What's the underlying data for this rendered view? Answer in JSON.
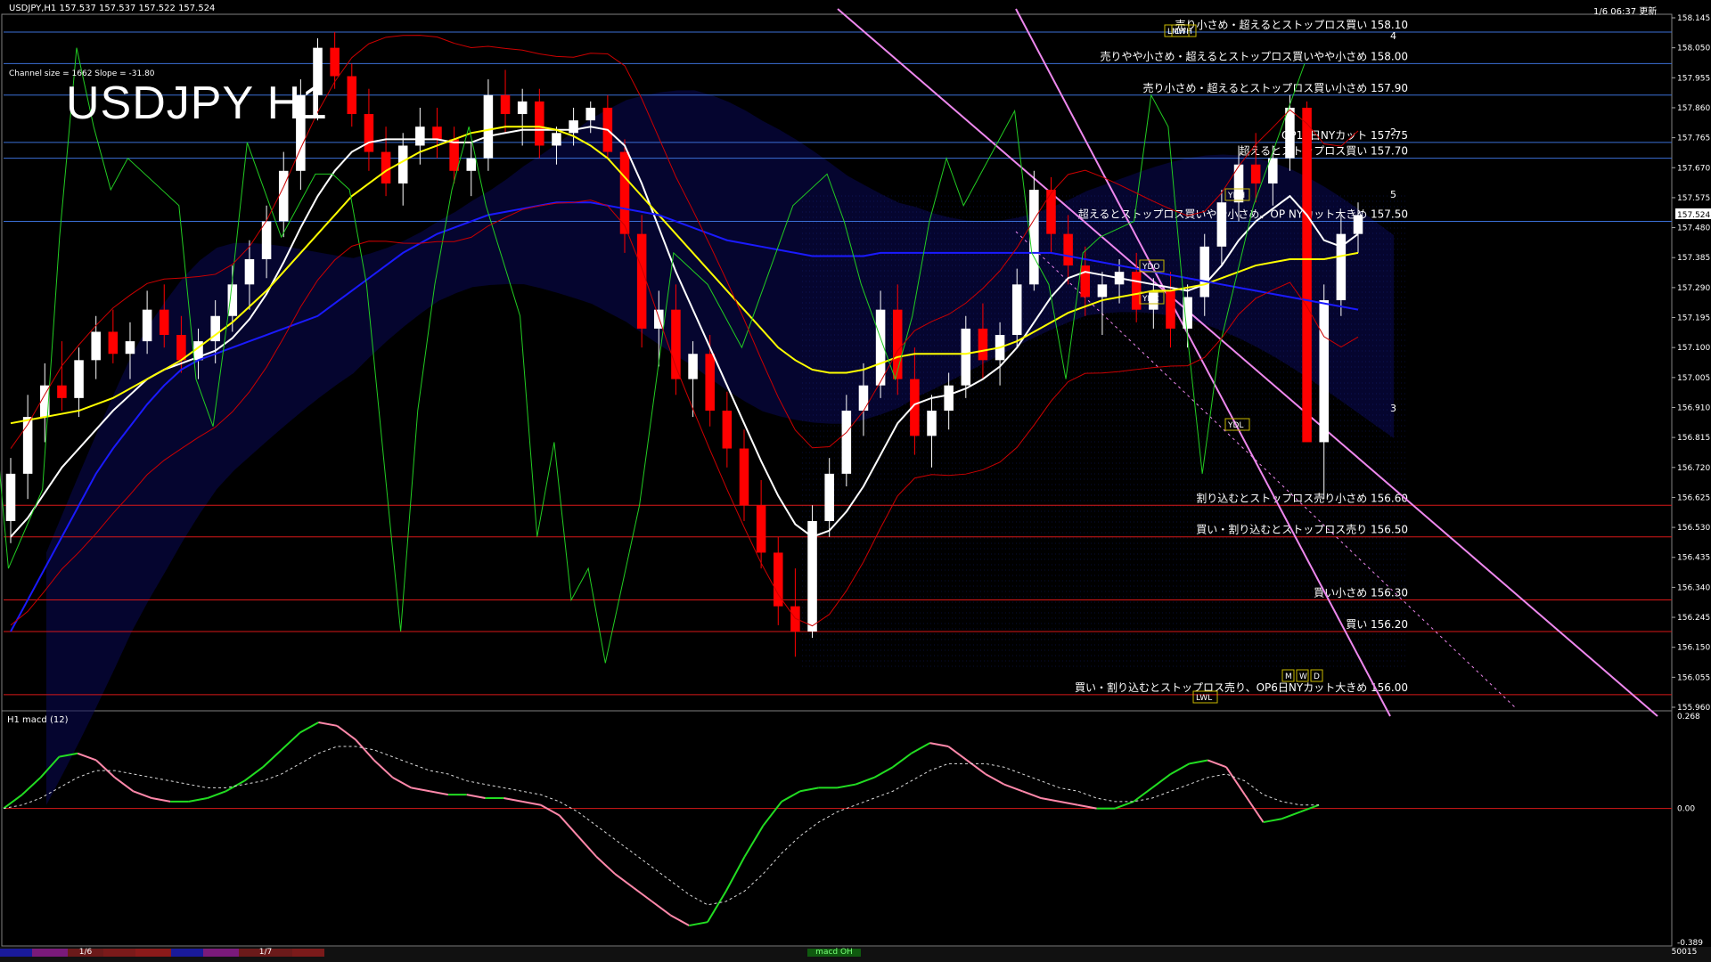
{
  "header": {
    "symbol_info": "USDJPY,H1  157.537 157.537 157.522 157.524",
    "title": "USDJPY H1",
    "channel_info": "Channel size = 1662 Slope = -31.80",
    "updated": "1/6 06:37 更新"
  },
  "colors": {
    "background": "#000000",
    "bull_candle": "#ffffff",
    "bear_candle": "#ff0000",
    "ma_white": "#ffffff",
    "ma_yellow": "#ffff00",
    "ma_blue": "#1a1aff",
    "chikou_green": "#22cc22",
    "bollinger_red": "#cc0000",
    "level_blue": "#3b6fd6",
    "level_red": "#d81818",
    "channel_pink": "#ee88ee",
    "macd_green": "#22dd22",
    "macd_pink": "#ff88aa"
  },
  "chart_data": [
    {
      "type": "line",
      "name": "price",
      "ylim": [
        155.96,
        158.145
      ],
      "y_ticks": [
        "158.145",
        "158.050",
        "157.955",
        "157.860",
        "157.765",
        "157.670",
        "157.575",
        "157.480",
        "157.385",
        "157.290",
        "157.195",
        "157.100",
        "157.005",
        "156.910",
        "156.815",
        "156.720",
        "156.625",
        "156.530",
        "156.435",
        "156.340",
        "156.245",
        "156.150",
        "156.055",
        "155.960"
      ],
      "current_price": "157.524",
      "candles_ohlc": [
        [
          156.55,
          156.75,
          156.48,
          156.7
        ],
        [
          156.7,
          156.95,
          156.62,
          156.88
        ],
        [
          156.88,
          157.05,
          156.8,
          156.98
        ],
        [
          156.98,
          157.12,
          156.9,
          156.94
        ],
        [
          156.94,
          157.1,
          156.88,
          157.06
        ],
        [
          157.06,
          157.2,
          157.0,
          157.15
        ],
        [
          157.15,
          157.22,
          157.05,
          157.08
        ],
        [
          157.08,
          157.18,
          157.0,
          157.12
        ],
        [
          157.12,
          157.28,
          157.08,
          157.22
        ],
        [
          157.22,
          157.3,
          157.1,
          157.14
        ],
        [
          157.14,
          157.2,
          157.02,
          157.06
        ],
        [
          157.06,
          157.16,
          157.0,
          157.12
        ],
        [
          157.12,
          157.25,
          157.05,
          157.2
        ],
        [
          157.2,
          157.36,
          157.15,
          157.3
        ],
        [
          157.3,
          157.44,
          157.22,
          157.38
        ],
        [
          157.38,
          157.55,
          157.32,
          157.5
        ],
        [
          157.5,
          157.72,
          157.45,
          157.66
        ],
        [
          157.66,
          157.95,
          157.6,
          157.9
        ],
        [
          157.9,
          158.08,
          157.82,
          158.05
        ],
        [
          158.05,
          158.1,
          157.92,
          157.96
        ],
        [
          157.96,
          158.0,
          157.8,
          157.84
        ],
        [
          157.84,
          157.92,
          157.66,
          157.72
        ],
        [
          157.72,
          157.8,
          157.58,
          157.62
        ],
        [
          157.62,
          157.78,
          157.55,
          157.74
        ],
        [
          157.74,
          157.86,
          157.68,
          157.8
        ],
        [
          157.8,
          157.86,
          157.7,
          157.76
        ],
        [
          157.76,
          157.8,
          157.62,
          157.66
        ],
        [
          157.66,
          157.75,
          157.58,
          157.7
        ],
        [
          157.7,
          157.95,
          157.66,
          157.9
        ],
        [
          157.9,
          157.98,
          157.78,
          157.84
        ],
        [
          157.84,
          157.92,
          157.74,
          157.88
        ],
        [
          157.88,
          157.92,
          157.7,
          157.74
        ],
        [
          157.74,
          157.8,
          157.68,
          157.78
        ],
        [
          157.78,
          157.86,
          157.74,
          157.82
        ],
        [
          157.82,
          157.88,
          157.78,
          157.86
        ],
        [
          157.86,
          157.9,
          157.7,
          157.72
        ],
        [
          157.72,
          157.76,
          157.4,
          157.46
        ],
        [
          157.46,
          157.52,
          157.1,
          157.16
        ],
        [
          157.16,
          157.28,
          157.04,
          157.22
        ],
        [
          157.22,
          157.3,
          156.95,
          157.0
        ],
        [
          157.0,
          157.12,
          156.88,
          157.08
        ],
        [
          157.08,
          157.14,
          156.85,
          156.9
        ],
        [
          156.9,
          156.96,
          156.72,
          156.78
        ],
        [
          156.78,
          156.84,
          156.55,
          156.6
        ],
        [
          156.6,
          156.68,
          156.4,
          156.45
        ],
        [
          156.45,
          156.5,
          156.22,
          156.28
        ],
        [
          156.28,
          156.4,
          156.12,
          156.2
        ],
        [
          156.2,
          156.6,
          156.18,
          156.55
        ],
        [
          156.55,
          156.75,
          156.5,
          156.7
        ],
        [
          156.7,
          156.95,
          156.66,
          156.9
        ],
        [
          156.9,
          157.05,
          156.82,
          156.98
        ],
        [
          156.98,
          157.28,
          156.94,
          157.22
        ],
        [
          157.22,
          157.3,
          156.95,
          157.0
        ],
        [
          157.0,
          157.1,
          156.76,
          156.82
        ],
        [
          156.82,
          156.95,
          156.72,
          156.9
        ],
        [
          156.9,
          157.02,
          156.84,
          156.98
        ],
        [
          156.98,
          157.2,
          156.94,
          157.16
        ],
        [
          157.16,
          157.24,
          157.0,
          157.06
        ],
        [
          157.06,
          157.18,
          156.98,
          157.14
        ],
        [
          157.14,
          157.35,
          157.1,
          157.3
        ],
        [
          157.3,
          157.66,
          157.28,
          157.6
        ],
        [
          157.6,
          157.64,
          157.4,
          157.46
        ],
        [
          157.46,
          157.52,
          157.3,
          157.36
        ],
        [
          157.36,
          157.42,
          157.2,
          157.26
        ],
        [
          157.26,
          157.34,
          157.14,
          157.3
        ],
        [
          157.3,
          157.38,
          157.24,
          157.34
        ],
        [
          157.34,
          157.4,
          157.18,
          157.22
        ],
        [
          157.22,
          157.32,
          157.16,
          157.28
        ],
        [
          157.28,
          157.34,
          157.1,
          157.16
        ],
        [
          157.16,
          157.3,
          157.1,
          157.26
        ],
        [
          157.26,
          157.46,
          157.2,
          157.42
        ],
        [
          157.42,
          157.6,
          157.36,
          157.56
        ],
        [
          157.56,
          157.74,
          157.5,
          157.68
        ],
        [
          157.68,
          157.78,
          157.56,
          157.62
        ],
        [
          157.62,
          157.74,
          157.55,
          157.7
        ],
        [
          157.7,
          157.9,
          157.66,
          157.86
        ],
        [
          157.86,
          157.88,
          156.95,
          156.8
        ],
        [
          156.8,
          157.3,
          156.62,
          157.25
        ],
        [
          157.25,
          157.52,
          157.2,
          157.46
        ],
        [
          157.46,
          157.56,
          157.4,
          157.52
        ]
      ],
      "series": [
        {
          "name": "ma_white",
          "values": [
            156.5,
            156.56,
            156.64,
            156.72,
            156.78,
            156.84,
            156.9,
            156.95,
            157.0,
            157.03,
            157.05,
            157.07,
            157.09,
            157.13,
            157.19,
            157.27,
            157.37,
            157.48,
            157.58,
            157.66,
            157.72,
            157.75,
            157.76,
            157.76,
            157.76,
            157.76,
            157.75,
            157.75,
            157.77,
            157.78,
            157.79,
            157.79,
            157.79,
            157.79,
            157.8,
            157.79,
            157.74,
            157.62,
            157.48,
            157.34,
            157.22,
            157.1,
            156.98,
            156.86,
            156.74,
            156.63,
            156.54,
            156.5,
            156.52,
            156.58,
            156.66,
            156.76,
            156.86,
            156.92,
            156.94,
            156.95,
            156.97,
            157.0,
            157.04,
            157.1,
            157.18,
            157.26,
            157.32,
            157.34,
            157.33,
            157.32,
            157.31,
            157.3,
            157.29,
            157.28,
            157.3,
            157.36,
            157.44,
            157.5,
            157.54,
            157.58,
            157.52,
            157.44,
            157.42,
            157.46
          ]
        },
        {
          "name": "ma_yellow",
          "values": [
            156.86,
            156.87,
            156.88,
            156.89,
            156.9,
            156.92,
            156.94,
            156.97,
            157.0,
            157.03,
            157.06,
            157.1,
            157.14,
            157.18,
            157.23,
            157.28,
            157.34,
            157.4,
            157.46,
            157.52,
            157.58,
            157.62,
            157.66,
            157.69,
            157.72,
            157.74,
            157.76,
            157.78,
            157.79,
            157.8,
            157.8,
            157.8,
            157.79,
            157.77,
            157.74,
            157.7,
            157.64,
            157.58,
            157.52,
            157.46,
            157.4,
            157.34,
            157.28,
            157.22,
            157.16,
            157.1,
            157.06,
            157.03,
            157.02,
            157.02,
            157.03,
            157.05,
            157.07,
            157.08,
            157.08,
            157.08,
            157.08,
            157.09,
            157.1,
            157.12,
            157.15,
            157.18,
            157.21,
            157.23,
            157.25,
            157.26,
            157.27,
            157.28,
            157.28,
            157.29,
            157.3,
            157.32,
            157.34,
            157.36,
            157.37,
            157.38,
            157.38,
            157.38,
            157.39,
            157.4
          ]
        },
        {
          "name": "ma_blue",
          "values": [
            156.2,
            156.3,
            156.4,
            156.5,
            156.6,
            156.7,
            156.78,
            156.85,
            156.92,
            156.98,
            157.03,
            157.06,
            157.08,
            157.1,
            157.12,
            157.14,
            157.16,
            157.18,
            157.2,
            157.24,
            157.28,
            157.32,
            157.36,
            157.4,
            157.43,
            157.46,
            157.48,
            157.5,
            157.52,
            157.53,
            157.54,
            157.55,
            157.56,
            157.56,
            157.56,
            157.55,
            157.54,
            157.53,
            157.52,
            157.5,
            157.48,
            157.46,
            157.44,
            157.43,
            157.42,
            157.41,
            157.4,
            157.39,
            157.39,
            157.39,
            157.39,
            157.4,
            157.4,
            157.4,
            157.4,
            157.4,
            157.4,
            157.4,
            157.4,
            157.4,
            157.4,
            157.4,
            157.39,
            157.38,
            157.37,
            157.36,
            157.35,
            157.34,
            157.33,
            157.32,
            157.31,
            157.3,
            157.29,
            157.28,
            157.27,
            157.26,
            157.25,
            157.24,
            157.23,
            157.22
          ]
        },
        {
          "name": "chikou_green",
          "values": [
            157.55,
            157.6,
            157.0,
            156.4,
            156.65,
            157.45,
            158.05,
            157.8,
            157.6,
            157.7,
            157.6,
            157.55,
            157.0,
            156.85,
            157.25,
            157.75,
            157.45,
            157.55,
            157.65,
            157.65,
            157.6,
            157.3,
            156.2,
            156.9,
            157.3,
            157.6,
            157.8,
            157.55,
            157.2,
            156.5,
            156.8,
            156.3,
            156.4,
            156.1,
            156.6,
            157.0,
            157.4,
            157.35,
            157.3,
            157.2,
            157.1,
            157.4,
            157.55,
            157.6,
            157.65,
            157.5,
            157.3,
            157.0,
            157.2,
            157.5,
            157.7,
            157.55,
            157.65,
            157.85,
            157.4,
            157.3,
            157.0,
            157.4,
            157.45,
            157.5,
            157.9,
            157.8,
            157.2,
            156.7,
            157.1,
            157.55,
            157.7,
            157.85,
            158.0
          ]
        }
      ],
      "levels": [
        {
          "price": 158.1,
          "color": "blue",
          "label": "売り小さめ・超えるとストップロス買い 158.10"
        },
        {
          "price": 158.0,
          "color": "blue",
          "label": "売りやや小さめ・超えるとストップロス買いやや小さめ 158.00"
        },
        {
          "price": 157.9,
          "color": "blue",
          "label": "売り小さめ・超えるとストップロス買い小さめ 157.90"
        },
        {
          "price": 157.75,
          "color": "blue",
          "label": "OP10日NYカット 157.75"
        },
        {
          "price": 157.7,
          "color": "blue",
          "label": "超えるとストップロス買い 157.70"
        },
        {
          "price": 157.5,
          "color": "blue",
          "label": "超えるとストップロス買いやや小さめ、OP NYカット大きめ 157.50"
        },
        {
          "price": 156.6,
          "color": "red",
          "label": "割り込むとストップロス売り小さめ 156.60"
        },
        {
          "price": 156.5,
          "color": "red",
          "label": "買い・割り込むとストップロス売り 156.50"
        },
        {
          "price": 156.3,
          "color": "red",
          "label": "買い小さめ 156.30"
        },
        {
          "price": 156.2,
          "color": "red",
          "label": "買い 156.20"
        },
        {
          "price": 156.0,
          "color": "red",
          "label": "買い・割り込むとストップロス売り、OP6日NYカット大きめ 156.00"
        }
      ],
      "box_labels": [
        "YDO",
        "YDC",
        "YDH",
        "YDL",
        "LWH",
        "LWL",
        "LMH",
        "M",
        "W",
        "D"
      ],
      "channel_markers": [
        "4",
        "2",
        "5",
        "3"
      ]
    },
    {
      "type": "line",
      "name": "macd",
      "title": "H1 macd (12)",
      "ylim": [
        -0.389,
        0.268
      ],
      "y_ticks": [
        "0.268",
        "0.00",
        "-0.389"
      ],
      "series": [
        {
          "name": "macd_main",
          "values": [
            0.0,
            0.04,
            0.09,
            0.15,
            0.16,
            0.14,
            0.09,
            0.05,
            0.03,
            0.02,
            0.02,
            0.03,
            0.05,
            0.08,
            0.12,
            0.17,
            0.22,
            0.25,
            0.24,
            0.2,
            0.14,
            0.09,
            0.06,
            0.05,
            0.04,
            0.04,
            0.03,
            0.03,
            0.02,
            0.01,
            -0.02,
            -0.08,
            -0.14,
            -0.19,
            -0.23,
            -0.27,
            -0.31,
            -0.34,
            -0.33,
            -0.24,
            -0.14,
            -0.05,
            0.02,
            0.05,
            0.06,
            0.06,
            0.07,
            0.09,
            0.12,
            0.16,
            0.19,
            0.18,
            0.14,
            0.1,
            0.07,
            0.05,
            0.03,
            0.02,
            0.01,
            0.0,
            0.0,
            0.02,
            0.06,
            0.1,
            0.13,
            0.14,
            0.12,
            0.04,
            -0.04,
            -0.03,
            -0.01,
            0.01
          ]
        },
        {
          "name": "macd_signal",
          "values": [
            0.0,
            0.01,
            0.03,
            0.06,
            0.09,
            0.11,
            0.11,
            0.1,
            0.09,
            0.08,
            0.07,
            0.06,
            0.06,
            0.07,
            0.08,
            0.1,
            0.13,
            0.16,
            0.18,
            0.18,
            0.17,
            0.15,
            0.13,
            0.11,
            0.1,
            0.08,
            0.07,
            0.06,
            0.05,
            0.04,
            0.02,
            -0.01,
            -0.05,
            -0.09,
            -0.13,
            -0.17,
            -0.21,
            -0.25,
            -0.28,
            -0.27,
            -0.24,
            -0.19,
            -0.13,
            -0.08,
            -0.04,
            -0.01,
            0.01,
            0.03,
            0.05,
            0.08,
            0.11,
            0.13,
            0.13,
            0.13,
            0.12,
            0.1,
            0.08,
            0.06,
            0.05,
            0.03,
            0.02,
            0.02,
            0.03,
            0.05,
            0.07,
            0.09,
            0.1,
            0.08,
            0.04,
            0.02,
            0.01,
            0.01
          ]
        }
      ]
    }
  ],
  "bottom_bar": {
    "tabs": [
      "1/6",
      "1/7"
    ],
    "indicator_label": "macd OH",
    "right_code": "50015"
  }
}
